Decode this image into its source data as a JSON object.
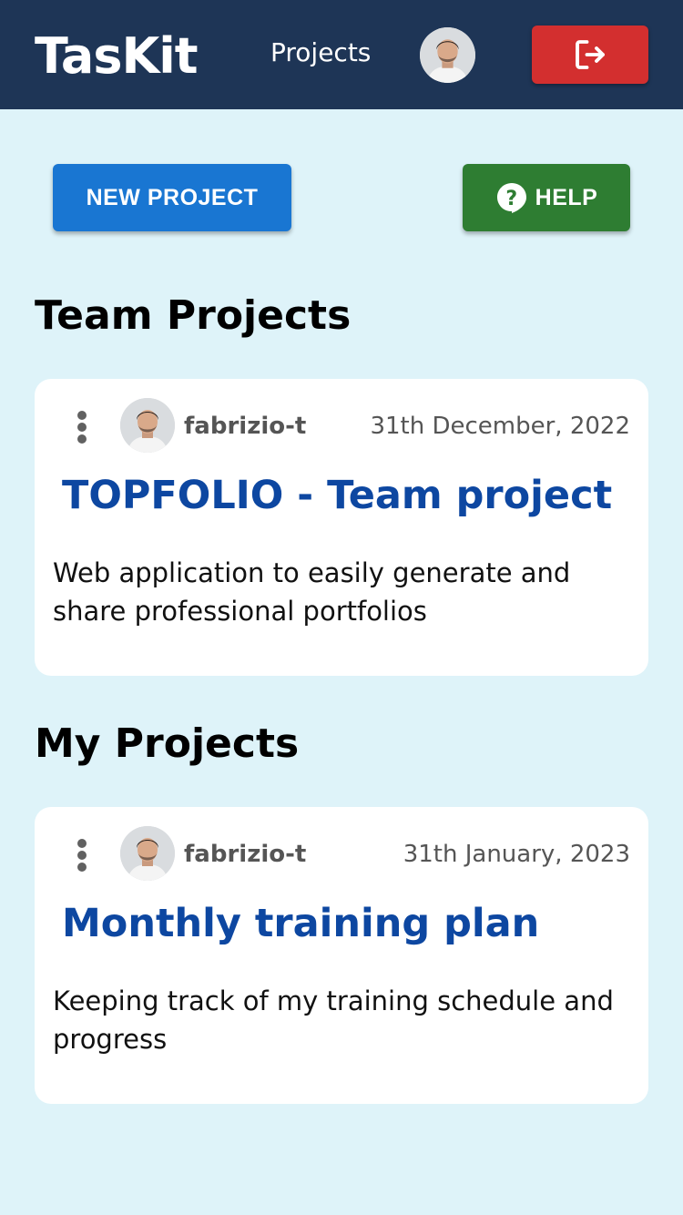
{
  "app": {
    "brand": "TasKit"
  },
  "nav": {
    "projects_label": "Projects"
  },
  "toolbar": {
    "new_project_label": "NEW PROJECT",
    "help_label": "HELP"
  },
  "sections": {
    "team_title": "Team Projects",
    "my_title": "My Projects"
  },
  "team_projects": [
    {
      "user": "fabrizio-t",
      "date": "31th December, 2022",
      "title": "TOPFOLIO - Team project",
      "description": "Web application to easily generate and share professional portfolios"
    }
  ],
  "my_projects": [
    {
      "user": "fabrizio-t",
      "date": "31th January, 2023",
      "title": "Monthly training plan",
      "description": "Keeping track of my training schedule and progress"
    }
  ],
  "icons": {
    "logout": "logout-icon",
    "help": "help-circle-icon",
    "menu": "more-vertical-icon"
  },
  "colors": {
    "navbar": "#1e3556",
    "background": "#def3f9",
    "logout": "#d32f2f",
    "new_project": "#1976d2",
    "help": "#2e7d32",
    "project_title": "#0d47a1"
  }
}
